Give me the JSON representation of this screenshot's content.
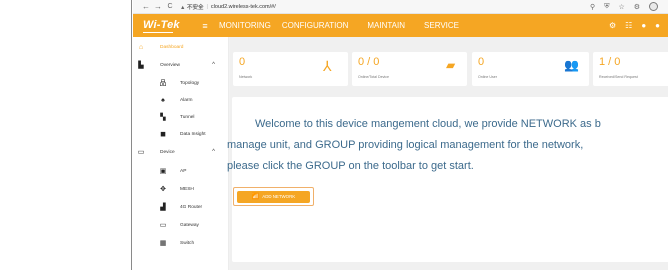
{
  "browser": {
    "back": "←",
    "forward": "→",
    "reload": "C",
    "security_label": "▲ 不安全",
    "url": "cloud2.wireless-tek.com/#/"
  },
  "header": {
    "logo": "Wi-Tek",
    "menu_icon": "≡",
    "nav": [
      {
        "label": "MONITORING",
        "active": true
      },
      {
        "label": "CONFIGURATION"
      },
      {
        "label": "MAINTAIN"
      },
      {
        "label": "SERVICE"
      }
    ],
    "accent": "#f5a623"
  },
  "sidebar": {
    "dashboard": "Dashboard",
    "overview": "Overview",
    "topology": "Topology",
    "alarm": "Alarm",
    "tunnel": "Tunnel",
    "data_insight": "Data Insight",
    "device": "Device",
    "ap": "AP",
    "mesh": "MESH",
    "router_4g": "4G Router",
    "gateway": "Gateway",
    "switch": "Switch"
  },
  "cards": [
    {
      "value": "0",
      "label": "Network",
      "icon": "network-icon"
    },
    {
      "value": "0 / 0",
      "label": "Online/Total Device",
      "icon": "router-icon"
    },
    {
      "value": "0",
      "label": "Online User",
      "icon": "users-icon"
    },
    {
      "value": "1 / 0",
      "label": "Received/Send Request",
      "icon": "request-icon"
    }
  ],
  "welcome": {
    "line1": "Welcome to this device mangement cloud, we provide NETWORK as b",
    "line2": "manage unit, and GROUP providing logical management for the network,",
    "line3": "please click the GROUP on the toolbar to get start.",
    "button": "ADD NETWORK"
  }
}
